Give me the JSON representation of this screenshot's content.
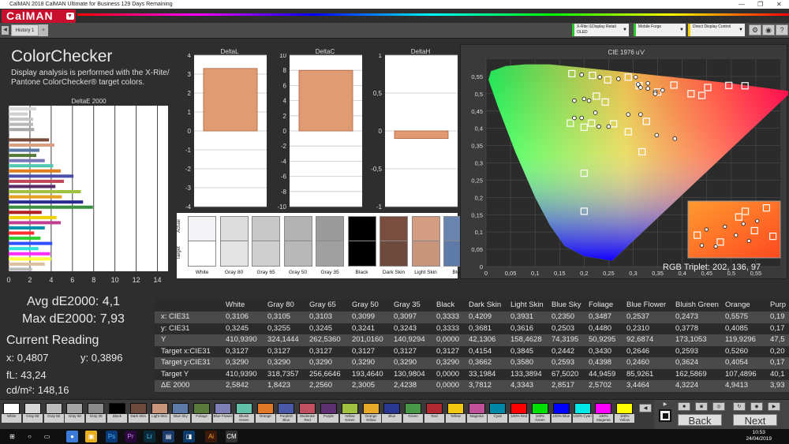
{
  "window": {
    "title": "CalMAN 2018 CalMAN Ultimate for Business 129 Days Remaining",
    "min": "—",
    "max": "❐",
    "close": "✕"
  },
  "app": {
    "logo": "CalMAN"
  },
  "tabs": [
    {
      "label": "History 1"
    },
    {
      "label": "+"
    }
  ],
  "devices": [
    {
      "label": "X-Rite i1Display Retail OLED",
      "color": "#2fc52f"
    },
    {
      "label": "Mobile Forge",
      "color": "#2fc52f"
    },
    {
      "label": "Direct Display Control",
      "color": "#f5d000"
    }
  ],
  "toolbar_icons": [
    "gear-icon",
    "settings-icon",
    "help-icon"
  ],
  "panel": {
    "title": "ColorChecker",
    "description": "Display analysis is performed with the X-Rite/ Pantone ColorChecker® target colors."
  },
  "stats": {
    "avg": "Avg dE2000: 4,1",
    "max": "Max dE2000: 7,93",
    "current": "Current Reading",
    "x": "x: 0,4807",
    "y": "y: 0,3896",
    "fl": "fL: 43,24",
    "cdm": "cd/m²: 148,16"
  },
  "deltae_chart": {
    "title": "DeltaE 2000",
    "xticks": [
      "0",
      "2",
      "4",
      "6",
      "8",
      "10",
      "12",
      "14"
    ],
    "bars": [
      {
        "v": 2.6,
        "c": "#d9d9d9"
      },
      {
        "v": 1.8,
        "c": "#d0d0d0"
      },
      {
        "v": 2.3,
        "c": "#c4c4c4"
      },
      {
        "v": 2.3,
        "c": "#b8b8b8"
      },
      {
        "v": 2.4,
        "c": "#a8a8a8"
      },
      {
        "v": 0.0,
        "c": "#111111"
      },
      {
        "v": 3.8,
        "c": "#7a4a3a"
      },
      {
        "v": 4.3,
        "c": "#d8a080"
      },
      {
        "v": 2.9,
        "c": "#5a78a8"
      },
      {
        "v": 2.6,
        "c": "#587a3a"
      },
      {
        "v": 3.4,
        "c": "#7878b8"
      },
      {
        "v": 4.2,
        "c": "#50c8b0"
      },
      {
        "v": 4.9,
        "c": "#e08020"
      },
      {
        "v": 6.1,
        "c": "#4a50a8"
      },
      {
        "v": 5.2,
        "c": "#c04858"
      },
      {
        "v": 4.4,
        "c": "#5a2a6a"
      },
      {
        "v": 6.8,
        "c": "#a0c040"
      },
      {
        "v": 5.0,
        "c": "#e8a020"
      },
      {
        "v": 7.0,
        "c": "#2a2a90"
      },
      {
        "v": 7.93,
        "c": "#3a9040"
      },
      {
        "v": 3.1,
        "c": "#b02020"
      },
      {
        "v": 4.5,
        "c": "#f0d000"
      },
      {
        "v": 4.9,
        "c": "#c04090"
      },
      {
        "v": 3.4,
        "c": "#0090b0"
      },
      {
        "v": 2.4,
        "c": "#ff3030"
      },
      {
        "v": 3.0,
        "c": "#30d030"
      },
      {
        "v": 4.1,
        "c": "#3050ff"
      },
      {
        "v": 2.8,
        "c": "#30e0e0"
      },
      {
        "v": 3.9,
        "c": "#ff30ff"
      },
      {
        "v": 4.0,
        "c": "#ffff40"
      },
      {
        "v": 3.4,
        "c": "#e0c0a0"
      },
      {
        "v": 2.2,
        "c": "#bbbbbb"
      }
    ]
  },
  "delta_charts": [
    {
      "title": "DeltaL",
      "yticks": [
        "4",
        "3",
        "2",
        "1",
        "0",
        "-1",
        "-2",
        "-3",
        "-4"
      ],
      "ymax": 4,
      "value": 3.3
    },
    {
      "title": "DeltaC",
      "yticks": [
        "10",
        "8",
        "6",
        "4",
        "2",
        "0",
        "-2",
        "-4",
        "-6",
        "-8",
        "-10"
      ],
      "ymax": 10,
      "value": 8.0
    },
    {
      "title": "DeltaH",
      "yticks": [
        "1",
        "0,5",
        "0",
        "-0,5",
        "-1"
      ],
      "ymax": 1,
      "value": -0.1
    }
  ],
  "swatch_strip": {
    "actual_label": "Actual",
    "target_label": "Target",
    "items": [
      {
        "label": "White",
        "a": "#f4f4f6",
        "t": "#ffffff"
      },
      {
        "label": "Gray 80",
        "a": "#dcdcdc",
        "t": "#e4e4e4"
      },
      {
        "label": "Gray 65",
        "a": "#c8c8c8",
        "t": "#cfcfcf"
      },
      {
        "label": "Gray 50",
        "a": "#b2b2b2",
        "t": "#b8b8b8"
      },
      {
        "label": "Gray 35",
        "a": "#9a9a9a",
        "t": "#a0a0a0"
      },
      {
        "label": "Black",
        "a": "#000000",
        "t": "#000000"
      },
      {
        "label": "Dark Skin",
        "a": "#7a4e3e",
        "t": "#6e4a3c"
      },
      {
        "label": "Light Skin",
        "a": "#d49c80",
        "t": "#c8957a"
      },
      {
        "label": "Blue",
        "a": "#6a84b0",
        "t": "#5d7aa8"
      }
    ]
  },
  "cie": {
    "title": "CIE 1976 u'v'",
    "xticks": [
      "0",
      "0,05",
      "0,1",
      "0,15",
      "0,2",
      "0,25",
      "0,3",
      "0,35",
      "0,4",
      "0,45",
      "0,5",
      "0,55"
    ],
    "yticks": [
      "0,55",
      "0,5",
      "0,45",
      "0,4",
      "0,35",
      "0,3",
      "0,25",
      "0,2",
      "0,15",
      "0,1",
      "0,05",
      "0"
    ],
    "rgb_triplet": "RGB Triplet: 202, 136, 97",
    "targets": [
      [
        0.175,
        0.558
      ],
      [
        0.217,
        0.553
      ],
      [
        0.29,
        0.548
      ],
      [
        0.248,
        0.54
      ],
      [
        0.312,
        0.523
      ],
      [
        0.35,
        0.505
      ],
      [
        0.383,
        0.525
      ],
      [
        0.418,
        0.5
      ],
      [
        0.452,
        0.518
      ],
      [
        0.495,
        0.524
      ],
      [
        0.528,
        0.523
      ],
      [
        0.44,
        0.495
      ],
      [
        0.225,
        0.493
      ],
      [
        0.243,
        0.476
      ],
      [
        0.172,
        0.415
      ],
      [
        0.215,
        0.415
      ],
      [
        0.2,
        0.403
      ],
      [
        0.26,
        0.413
      ],
      [
        0.29,
        0.39
      ],
      [
        0.327,
        0.42
      ],
      [
        0.318,
        0.332
      ],
      [
        0.2,
        0.27
      ],
      [
        0.2,
        0.16
      ]
    ],
    "measured": [
      [
        0.195,
        0.555
      ],
      [
        0.232,
        0.548
      ],
      [
        0.27,
        0.543
      ],
      [
        0.305,
        0.548
      ],
      [
        0.33,
        0.53
      ],
      [
        0.36,
        0.51
      ],
      [
        0.31,
        0.527
      ],
      [
        0.33,
        0.515
      ],
      [
        0.345,
        0.505
      ],
      [
        0.315,
        0.518
      ],
      [
        0.18,
        0.48
      ],
      [
        0.2,
        0.485
      ],
      [
        0.18,
        0.43
      ],
      [
        0.195,
        0.43
      ],
      [
        0.223,
        0.445
      ],
      [
        0.23,
        0.405
      ],
      [
        0.25,
        0.405
      ],
      [
        0.29,
        0.44
      ],
      [
        0.315,
        0.44
      ],
      [
        0.348,
        0.38
      ],
      [
        0.385,
        0.37
      ],
      [
        0.345,
        0.5
      ],
      [
        0.21,
        0.48
      ]
    ]
  },
  "table": {
    "headers": [
      "",
      "White",
      "Gray 80",
      "Gray 65",
      "Gray 50",
      "Gray 35",
      "Black",
      "Dark Skin",
      "Light Skin",
      "Blue Sky",
      "Foliage",
      "Blue Flower",
      "Bluish Green",
      "Orange",
      "Purp"
    ],
    "rows": [
      [
        "x: CIE31",
        "0,3106",
        "0,3105",
        "0,3103",
        "0,3099",
        "0,3097",
        "0,3333",
        "0,4209",
        "0,3931",
        "0,2350",
        "0,3487",
        "0,2537",
        "0,2473",
        "0,5575",
        "0,19"
      ],
      [
        "y: CIE31",
        "0,3245",
        "0,3255",
        "0,3245",
        "0,3241",
        "0,3243",
        "0,3333",
        "0,3681",
        "0,3616",
        "0,2503",
        "0,4480",
        "0,2310",
        "0,3778",
        "0,4085",
        "0,17"
      ],
      [
        "Y",
        "410,9390",
        "324,1444",
        "262,5360",
        "201,0160",
        "140,9294",
        "0,0000",
        "42,1306",
        "158,4628",
        "74,3195",
        "50,9295",
        "92,6874",
        "173,1053",
        "119,9296",
        "47,5"
      ],
      [
        "Target x:CIE31",
        "0,3127",
        "0,3127",
        "0,3127",
        "0,3127",
        "0,3127",
        "0,3127",
        "0,4154",
        "0,3845",
        "0,2442",
        "0,3430",
        "0,2646",
        "0,2593",
        "0,5260",
        "0,20"
      ],
      [
        "Target y:CIE31",
        "0,3290",
        "0,3290",
        "0,3290",
        "0,3290",
        "0,3290",
        "0,3290",
        "0,3662",
        "0,3580",
        "0,2593",
        "0,4398",
        "0,2460",
        "0,3624",
        "0,4054",
        "0,17"
      ],
      [
        "Target Y",
        "410,9390",
        "318,7357",
        "256,6646",
        "193,4640",
        "130,9804",
        "0,0000",
        "33,1984",
        "133,3894",
        "67,5020",
        "44,9459",
        "85,9261",
        "162,5869",
        "107,4896",
        "40,1"
      ],
      [
        "ΔE 2000",
        "2,5842",
        "1,8423",
        "2,2560",
        "2,3005",
        "2,4238",
        "0,0000",
        "3,7812",
        "4,3343",
        "2,8517",
        "2,5702",
        "3,4464",
        "4,3224",
        "4,9413",
        "3,93"
      ]
    ]
  },
  "patches": [
    {
      "label": "White",
      "c": "#ffffff"
    },
    {
      "label": "Gray 80",
      "c": "#d6d6d6"
    },
    {
      "label": "Gray 65",
      "c": "#bdbdbd"
    },
    {
      "label": "Gray 50",
      "c": "#a5a5a5"
    },
    {
      "label": "Gray 35",
      "c": "#8a8a8a"
    },
    {
      "label": "Black",
      "c": "#000000"
    },
    {
      "label": "Dark Skin",
      "c": "#6e4a3c"
    },
    {
      "label": "Light Skin",
      "c": "#c8957a"
    },
    {
      "label": "Blue Sky",
      "c": "#5d7aa8"
    },
    {
      "label": "Foliage",
      "c": "#587a3a"
    },
    {
      "label": "Blue Flower",
      "c": "#7f7fb8"
    },
    {
      "label": "Bluish Green",
      "c": "#60c0a8"
    },
    {
      "label": "Orange",
      "c": "#e07828"
    },
    {
      "label": "Purplish Blue",
      "c": "#4a58a8"
    },
    {
      "label": "Moderate Red",
      "c": "#c05060"
    },
    {
      "label": "Purple",
      "c": "#5c3070"
    },
    {
      "label": "Yellow Green",
      "c": "#a0c040"
    },
    {
      "label": "Orange Yellow",
      "c": "#e8a828"
    },
    {
      "label": "Blue",
      "c": "#283890"
    },
    {
      "label": "Green",
      "c": "#489848"
    },
    {
      "label": "Red",
      "c": "#b02830"
    },
    {
      "label": "Yellow",
      "c": "#f0c810"
    },
    {
      "label": "Magenta",
      "c": "#c05098"
    },
    {
      "label": "Cyan",
      "c": "#0088a8"
    },
    {
      "label": "100% Red",
      "c": "#ff0000"
    },
    {
      "label": "100% Green",
      "c": "#00e000"
    },
    {
      "label": "100% Blue",
      "c": "#0000ff"
    },
    {
      "label": "100% Cyan",
      "c": "#00e8e8"
    },
    {
      "label": "100% Magenta",
      "c": "#ff00ff"
    },
    {
      "label": "100% Yellow",
      "c": "#ffff00"
    },
    {
      "label": "Light Skin",
      "c": "#8a5a40"
    }
  ],
  "nav": {
    "back": "Back",
    "next": "Next"
  },
  "taskbar": {
    "time": "10:53",
    "date": "24/04/2019"
  }
}
